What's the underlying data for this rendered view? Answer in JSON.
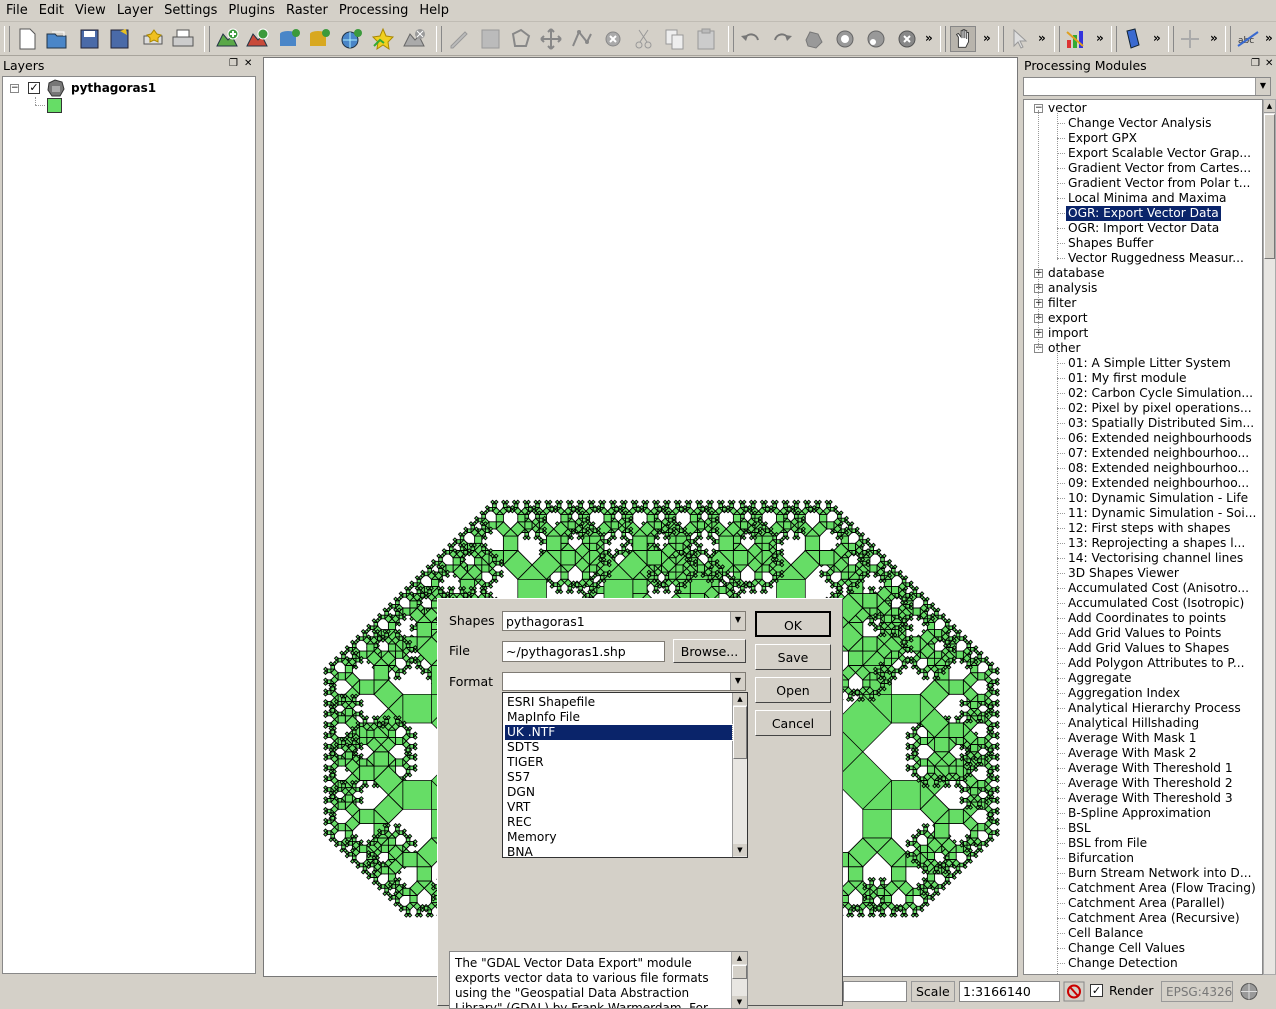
{
  "menu": [
    "File",
    "Edit",
    "View",
    "Layer",
    "Settings",
    "Plugins",
    "Raster",
    "Processing",
    "Help"
  ],
  "layers": {
    "title": "Layers",
    "layer_name": "pythagoras1",
    "checked": true,
    "symbol_color": "#66dd66"
  },
  "processing": {
    "title": "Processing Modules",
    "tree": [
      {
        "label": "vector",
        "level": 0,
        "expander": "-"
      },
      {
        "label": "Change Vector Analysis",
        "level": 1
      },
      {
        "label": "Export GPX",
        "level": 1
      },
      {
        "label": "Export Scalable Vector Grap...",
        "level": 1
      },
      {
        "label": "Gradient Vector from Cartes...",
        "level": 1
      },
      {
        "label": "Gradient Vector from Polar t...",
        "level": 1
      },
      {
        "label": "Local Minima and Maxima",
        "level": 1
      },
      {
        "label": "OGR: Export Vector Data",
        "level": 1,
        "selected": true
      },
      {
        "label": "OGR: Import Vector Data",
        "level": 1
      },
      {
        "label": "Shapes Buffer",
        "level": 1
      },
      {
        "label": "Vector Ruggedness Measur...",
        "level": 1
      },
      {
        "label": "database",
        "level": 0,
        "expander": "+"
      },
      {
        "label": "analysis",
        "level": 0,
        "expander": "+"
      },
      {
        "label": "filter",
        "level": 0,
        "expander": "+"
      },
      {
        "label": "export",
        "level": 0,
        "expander": "+"
      },
      {
        "label": "import",
        "level": 0,
        "expander": "+"
      },
      {
        "label": "other",
        "level": 0,
        "expander": "-"
      },
      {
        "label": "01: A Simple Litter System",
        "level": 1
      },
      {
        "label": "01: My first module",
        "level": 1
      },
      {
        "label": "02: Carbon Cycle Simulation...",
        "level": 1
      },
      {
        "label": "02: Pixel by pixel operations...",
        "level": 1
      },
      {
        "label": "03: Spatially Distributed Sim...",
        "level": 1
      },
      {
        "label": "06: Extended neighbourhoods",
        "level": 1
      },
      {
        "label": "07: Extended neighbourhoo...",
        "level": 1
      },
      {
        "label": "08: Extended neighbourhoo...",
        "level": 1
      },
      {
        "label": "09: Extended neighbourhoo...",
        "level": 1
      },
      {
        "label": "10: Dynamic Simulation - Life",
        "level": 1
      },
      {
        "label": "11: Dynamic Simulation - Soi...",
        "level": 1
      },
      {
        "label": "12: First steps with shapes",
        "level": 1
      },
      {
        "label": "13: Reprojecting a shapes l...",
        "level": 1
      },
      {
        "label": "14: Vectorising channel lines",
        "level": 1
      },
      {
        "label": "3D Shapes Viewer",
        "level": 1
      },
      {
        "label": "Accumulated Cost (Anisotro...",
        "level": 1
      },
      {
        "label": "Accumulated Cost (Isotropic)",
        "level": 1
      },
      {
        "label": "Add Coordinates to points",
        "level": 1
      },
      {
        "label": "Add Grid Values to Points",
        "level": 1
      },
      {
        "label": "Add Grid Values to Shapes",
        "level": 1
      },
      {
        "label": "Add Polygon Attributes to P...",
        "level": 1
      },
      {
        "label": "Aggregate",
        "level": 1
      },
      {
        "label": "Aggregation Index",
        "level": 1
      },
      {
        "label": "Analytical Hierarchy Process",
        "level": 1
      },
      {
        "label": "Analytical Hillshading",
        "level": 1
      },
      {
        "label": "Average With Mask 1",
        "level": 1
      },
      {
        "label": "Average With Mask 2",
        "level": 1
      },
      {
        "label": "Average With Thereshold 1",
        "level": 1
      },
      {
        "label": "Average With Thereshold 2",
        "level": 1
      },
      {
        "label": "Average With Thereshold 3",
        "level": 1
      },
      {
        "label": "B-Spline Approximation",
        "level": 1
      },
      {
        "label": "BSL",
        "level": 1
      },
      {
        "label": "BSL from File",
        "level": 1
      },
      {
        "label": "Bifurcation",
        "level": 1
      },
      {
        "label": "Burn Stream Network into D...",
        "level": 1
      },
      {
        "label": "Catchment Area (Flow Tracing)",
        "level": 1
      },
      {
        "label": "Catchment Area (Parallel)",
        "level": 1
      },
      {
        "label": "Catchment Area (Recursive)",
        "level": 1
      },
      {
        "label": "Cell Balance",
        "level": 1
      },
      {
        "label": "Change Cell Values",
        "level": 1
      },
      {
        "label": "Change Detection",
        "level": 1
      }
    ]
  },
  "dialog": {
    "shapes_label": "Shapes",
    "shapes_value": "pythagoras1",
    "file_label": "File",
    "file_value": "~/pythagoras1.shp",
    "browse_label": "Browse...",
    "format_label": "Format",
    "format_value": "",
    "format_options": [
      "ESRI Shapefile",
      "MapInfo File",
      "UK .NTF",
      "SDTS",
      "TIGER",
      "S57",
      "DGN",
      "VRT",
      "REC",
      "Memory",
      "BNA"
    ],
    "selected_option": "UK .NTF",
    "ok_label": "OK",
    "save_label": "Save",
    "open_label": "Open",
    "cancel_label": "Cancel",
    "description": "The \"GDAL Vector Data Export\" module exports vector data to various file formats using the \"Geospatial Data Abstraction Library\" (GDAL) by Frank Warmerdam. For"
  },
  "status": {
    "scale_label": "Scale",
    "scale_value": "1:3166140",
    "render_label": "Render",
    "render_checked": true,
    "crs": "EPSG:4326"
  },
  "map": {
    "fill_color": "#66dd66",
    "edge_color": "#000000"
  }
}
